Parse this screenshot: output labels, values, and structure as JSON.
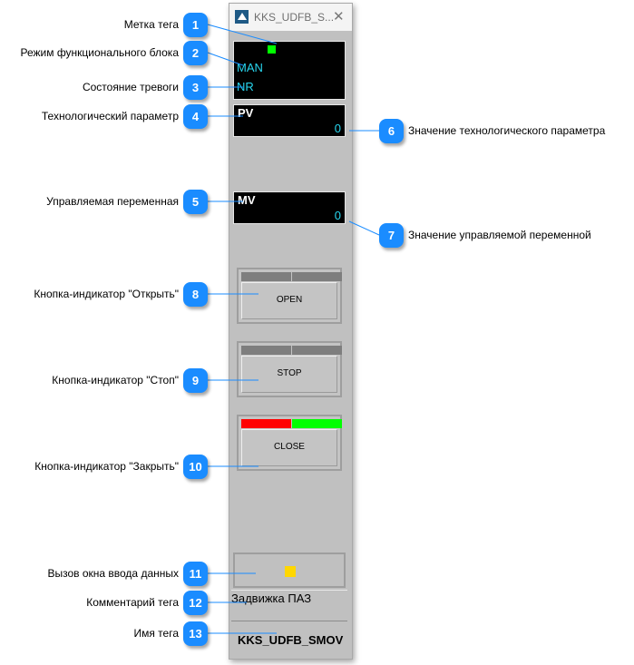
{
  "window": {
    "title": "KKS_UDFB_S...",
    "app_icon": "app-logo-icon",
    "close_icon": "close-icon"
  },
  "faceplate": {
    "tag_mark_color": "#00ff00",
    "mode": "MAN",
    "alarm_state": "NR",
    "pv": {
      "label": "PV",
      "value": "0"
    },
    "mv": {
      "label": "MV",
      "value": "0"
    },
    "buttons": [
      {
        "label": "OPEN",
        "indicator_left": "#7e7e7e",
        "indicator_right": "#7e7e7e"
      },
      {
        "label": "STOP",
        "indicator_left": "#7e7e7e",
        "indicator_right": "#7e7e7e"
      },
      {
        "label": "CLOSE",
        "indicator_left": "#ff0000",
        "indicator_right": "#00ff00"
      }
    ],
    "data_input_indicator_color": "#ffd700",
    "comment": "Задвижка ПАЗ",
    "tag_name": "KKS_UDFB_SMOV"
  },
  "callouts": [
    {
      "num": "1",
      "text": "Метка тега"
    },
    {
      "num": "2",
      "text": "Режим функционального блока"
    },
    {
      "num": "3",
      "text": "Состояние тревоги"
    },
    {
      "num": "4",
      "text": "Технологический параметр"
    },
    {
      "num": "5",
      "text": "Управляемая переменная"
    },
    {
      "num": "6",
      "text": "Значение технологического параметра"
    },
    {
      "num": "7",
      "text": "Значение управляемой переменной"
    },
    {
      "num": "8",
      "text": "Кнопка-индикатор \"Открыть\""
    },
    {
      "num": "9",
      "text": "Кнопка-индикатор \"Стоп\""
    },
    {
      "num": "10",
      "text": "Кнопка-индикатор \"Закрыть\""
    },
    {
      "num": "11",
      "text": "Вызов окна ввода данных"
    },
    {
      "num": "12",
      "text": "Комментарий тега"
    },
    {
      "num": "13",
      "text": "Имя тега"
    }
  ]
}
